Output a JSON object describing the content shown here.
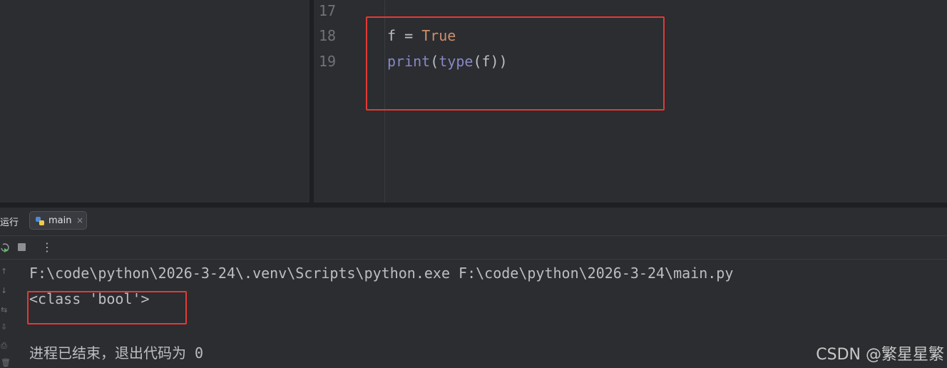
{
  "editor": {
    "line_numbers": [
      "17",
      "18",
      "19"
    ],
    "line18": {
      "var": "f",
      "op": "=",
      "value": "True"
    },
    "line19": {
      "fn_print": "print",
      "open1": "(",
      "fn_type": "type",
      "open2": "(",
      "arg": "f",
      "close": "))"
    }
  },
  "run_panel": {
    "title": "运行",
    "tab_label": "main",
    "tab_close": "×",
    "more_menu": "⋮"
  },
  "console": {
    "command": "F:\\code\\python\\2026-3-24\\.venv\\Scripts\\python.exe F:\\code\\python\\2026-3-24\\main.py",
    "output": "<class 'bool'>",
    "exit_message": "进程已结束，退出代码为 0"
  },
  "watermark": "CSDN @繁星星繁",
  "colors": {
    "background": "#2b2d30",
    "keyword": "#cf8e6d",
    "builtin": "#8888c6",
    "highlight_box": "#e53935"
  }
}
